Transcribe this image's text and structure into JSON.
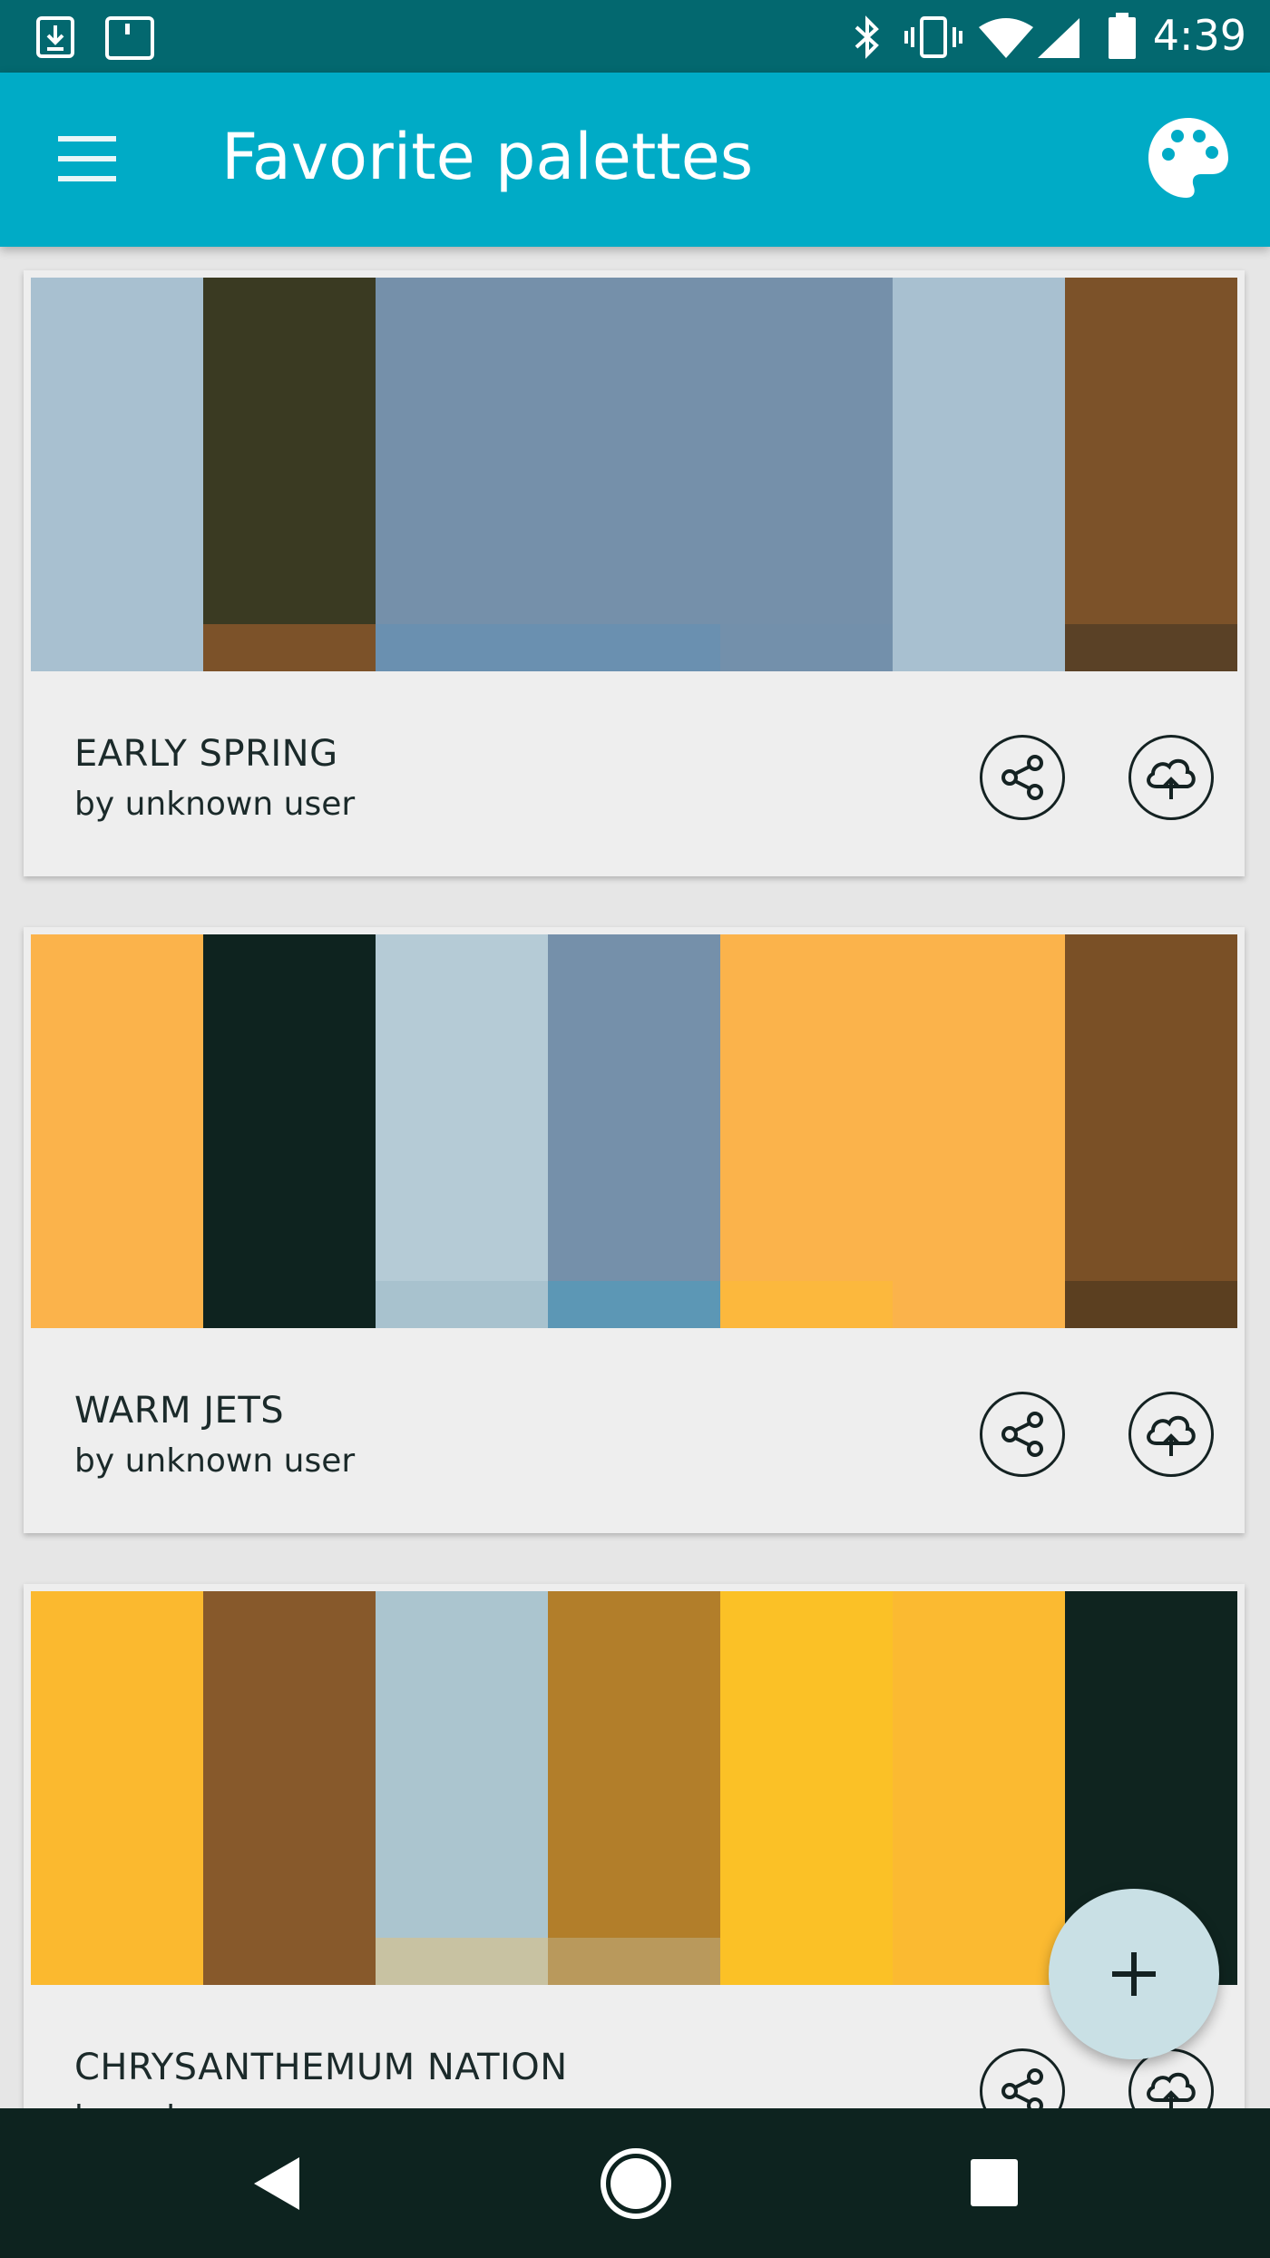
{
  "status_bar": {
    "time": "4:39",
    "icons": [
      "download-icon",
      "notification-icon",
      "bluetooth-icon",
      "vibrate-icon",
      "wifi-icon",
      "signal-icon",
      "battery-icon"
    ]
  },
  "app_bar": {
    "title": "Favorite palettes",
    "menu_icon": "menu-icon",
    "action_icon": "palette-icon"
  },
  "palettes": [
    {
      "name": "EARLY SPRING",
      "author": "by unknown user",
      "colors": [
        "#a8c0d0",
        "#3a3a22",
        "#7590aa",
        "#7590aa",
        "#7590aa",
        "#a8c0d0",
        "#7c5229"
      ],
      "bands": [
        "#a8c0d0",
        "#7c5229",
        "#6a90b0",
        "#6a90b0",
        "#7390ab",
        "#a8c0d0",
        "#5a4126"
      ]
    },
    {
      "name": "WARM JETS",
      "author": "by unknown user",
      "colors": [
        "#fbb34b",
        "#0e231f",
        "#b5cbd6",
        "#7590aa",
        "#fbb34b",
        "#fbb34b",
        "#7a5026"
      ],
      "bands": [
        "#fbb34b",
        "#0e231f",
        "#a8c2ce",
        "#5c97b5",
        "#fcb83d",
        "#fbb34b",
        "#5b3f20"
      ]
    },
    {
      "name": "CHRYSANTHEMUM NATION",
      "author": "by unknown user",
      "colors": [
        "#fbb92f",
        "#87592b",
        "#abc5cf",
        "#b27e2a",
        "#fbc126",
        "#fbba31",
        "#0f241f"
      ],
      "bands": [
        "#fbb92f",
        "#87592b",
        "#c8c2a2",
        "#b9995c",
        "#fbc126",
        "#fbba31",
        "#0f241f"
      ]
    }
  ],
  "actions": {
    "share_icon": "share-icon",
    "upload_icon": "cloud-upload-icon"
  },
  "fab": {
    "label": "+",
    "icon": "add-icon"
  },
  "nav_bar": {
    "icons": [
      "back-icon",
      "home-icon",
      "recents-icon"
    ]
  },
  "colors": {
    "status_bar": "#03686f",
    "app_bar": "#00abc6",
    "nav_bar": "#0d231f",
    "card": "#eeeeee",
    "fab": "#c9e0e5"
  }
}
